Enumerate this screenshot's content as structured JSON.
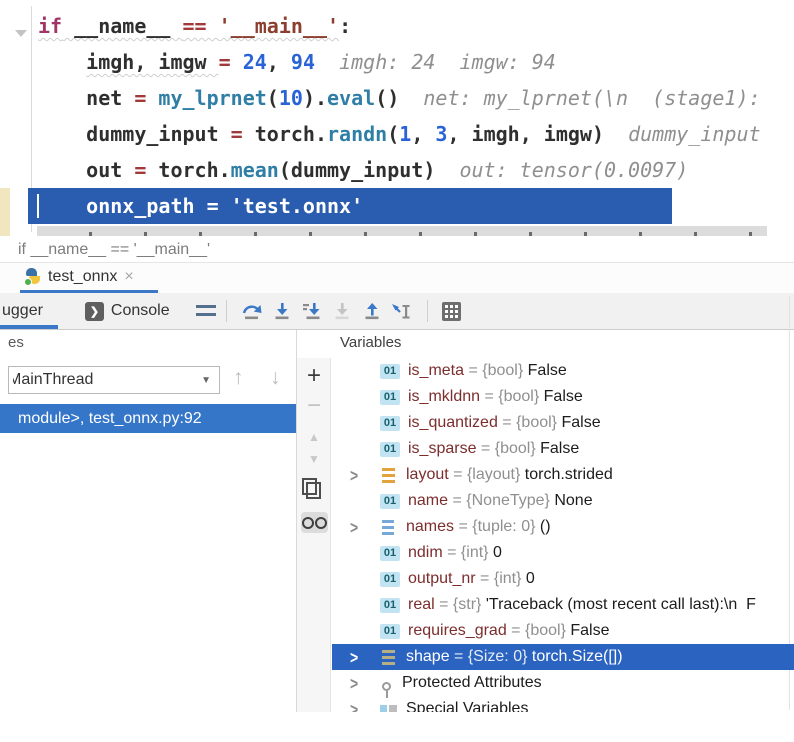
{
  "editor": {
    "lines": [
      {
        "tokens": [
          {
            "t": "if",
            "c": "k",
            "u": true
          },
          {
            "t": " __name__ ",
            "c": "v",
            "u": true
          },
          {
            "t": "== ",
            "c": "o",
            "u": true
          },
          {
            "t": "'__main__'",
            "c": "s",
            "u": true
          },
          {
            "t": ":",
            "c": "v"
          }
        ]
      },
      {
        "tokens": [
          {
            "t": "    ",
            "c": "v"
          },
          {
            "t": "imgh, imgw ",
            "c": "v",
            "u": true
          },
          {
            "t": "= ",
            "c": "o"
          },
          {
            "t": "24",
            "c": "n"
          },
          {
            "t": ", ",
            "c": "v"
          },
          {
            "t": "94",
            "c": "n"
          },
          {
            "t": "  imgh: 24  imgw: 94",
            "c": "h"
          }
        ]
      },
      {
        "tokens": [
          {
            "t": "    net ",
            "c": "v"
          },
          {
            "t": "= ",
            "c": "o"
          },
          {
            "t": "my_lprnet",
            "c": "f"
          },
          {
            "t": "(",
            "c": "v"
          },
          {
            "t": "10",
            "c": "n"
          },
          {
            "t": ").",
            "c": "v"
          },
          {
            "t": "eval",
            "c": "f"
          },
          {
            "t": "()",
            "c": "v"
          },
          {
            "t": "  net: my_lprnet(\\n  (stage1):",
            "c": "h"
          }
        ]
      },
      {
        "tokens": [
          {
            "t": "    dummy_input ",
            "c": "v"
          },
          {
            "t": "= ",
            "c": "o"
          },
          {
            "t": "torch.",
            "c": "v"
          },
          {
            "t": "randn",
            "c": "f"
          },
          {
            "t": "(",
            "c": "v"
          },
          {
            "t": "1",
            "c": "n"
          },
          {
            "t": ", ",
            "c": "v"
          },
          {
            "t": "3",
            "c": "n"
          },
          {
            "t": ", imgh, imgw)",
            "c": "v"
          },
          {
            "t": "  dummy_input",
            "c": "h"
          }
        ]
      },
      {
        "tokens": [
          {
            "t": "    out ",
            "c": "v"
          },
          {
            "t": "= ",
            "c": "o"
          },
          {
            "t": "torch.",
            "c": "v"
          },
          {
            "t": "mean",
            "c": "f"
          },
          {
            "t": "(dummy_input)",
            "c": "v"
          },
          {
            "t": "  out: tensor(0.0097)",
            "c": "h"
          }
        ]
      },
      {
        "exec": true,
        "tokens": [
          {
            "t": "    onnx_path ",
            "c": "w"
          },
          {
            "t": "= ",
            "c": "w"
          },
          {
            "t": "'test.onnx'",
            "c": "ws"
          }
        ]
      }
    ]
  },
  "breadcrumb": "if __name__ == '__main__'",
  "tab": {
    "title": "test_onnx",
    "close": "×"
  },
  "debug_toolbar": {
    "debugger_label": "ugger",
    "console_label": "Console",
    "console_glyph": "❯"
  },
  "frames_panel": {
    "header": "es",
    "thread": "MainThread",
    "dropdown_arrow": "▼",
    "up_arrow": "↑",
    "down_arrow": "↓",
    "frame": "module>, test_onnx.py:92"
  },
  "variables_panel": {
    "header": "Variables",
    "toolbar": {
      "add": "+",
      "remove": "−",
      "up": "▲",
      "down": "▼"
    },
    "rows": [
      {
        "icon": "b01",
        "badge": "01",
        "name": "is_meta",
        "type": "{bool}",
        "value": "False"
      },
      {
        "icon": "b01",
        "badge": "01",
        "name": "is_mkldnn",
        "type": "{bool}",
        "value": "False"
      },
      {
        "icon": "b01",
        "badge": "01",
        "name": "is_quantized",
        "type": "{bool}",
        "value": "False"
      },
      {
        "icon": "b01",
        "badge": "01",
        "name": "is_sparse",
        "type": "{bool}",
        "value": "False"
      },
      {
        "icon": "bars-orange",
        "expandable": true,
        "name": "layout",
        "type": "{layout}",
        "value": "torch.strided"
      },
      {
        "icon": "b01",
        "badge": "01",
        "name": "name",
        "type": "{NoneType}",
        "value": "None"
      },
      {
        "icon": "bars-numbered",
        "expandable": true,
        "name": "names",
        "type": "{tuple: 0}",
        "value": "()"
      },
      {
        "icon": "b01",
        "badge": "01",
        "name": "ndim",
        "type": "{int}",
        "value": "0"
      },
      {
        "icon": "b01",
        "badge": "01",
        "name": "output_nr",
        "type": "{int}",
        "value": "0"
      },
      {
        "icon": "b01",
        "badge": "01",
        "name": "real",
        "type": "{str}",
        "value": "'Traceback (most recent call last):\\n  F"
      },
      {
        "icon": "b01",
        "badge": "01",
        "name": "requires_grad",
        "type": "{bool}",
        "value": "False"
      },
      {
        "icon": "bars-olive",
        "expandable": true,
        "selected": true,
        "name": "shape",
        "type": "{Size: 0}",
        "value": "torch.Size([])"
      },
      {
        "icon": "key",
        "expandable": true,
        "group": true,
        "label": "Protected Attributes"
      },
      {
        "icon": "squares",
        "expandable": true,
        "group": true,
        "label": "Special Variables"
      }
    ]
  }
}
